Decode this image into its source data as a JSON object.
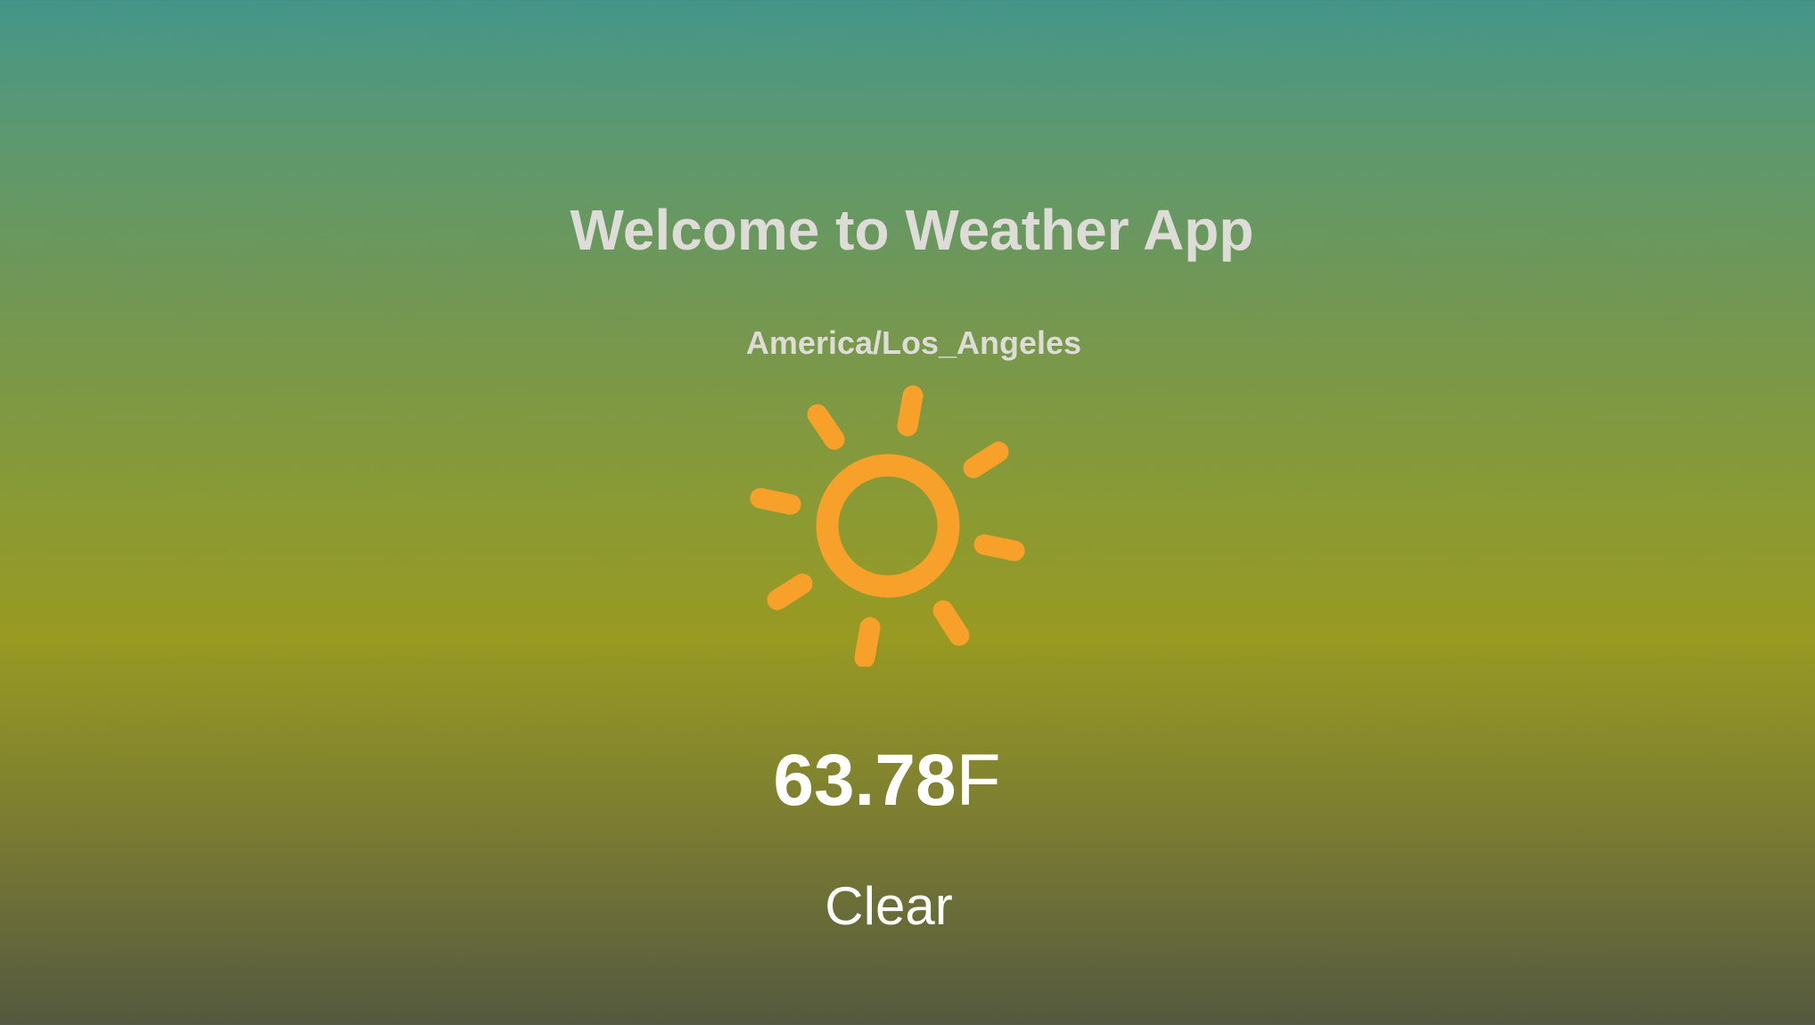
{
  "header": {
    "title": "Welcome to Weather App"
  },
  "location": {
    "timezone": "America/Los_Angeles"
  },
  "weather": {
    "icon": "sun-icon",
    "temperature_value": "63.78",
    "temperature_unit": "F",
    "condition": "Clear"
  },
  "colors": {
    "icon": "#f7a12a",
    "heading_text": "#dedcd6",
    "value_text": "#ffffff"
  }
}
